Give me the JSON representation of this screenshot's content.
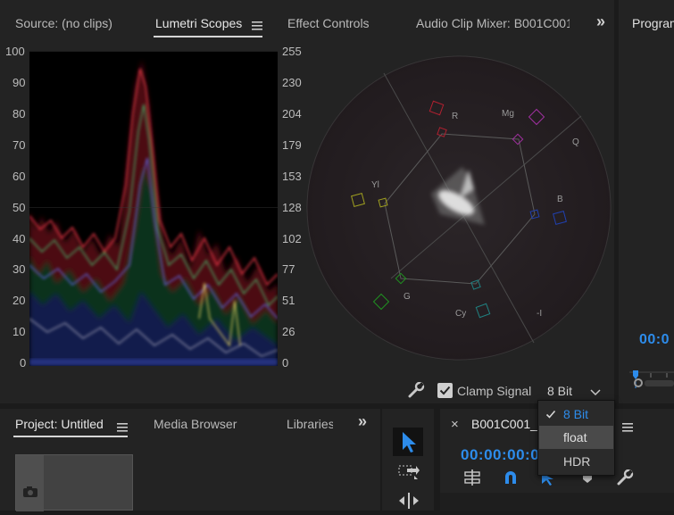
{
  "top_panel": {
    "tabs": [
      {
        "label": "Source: (no clips)"
      },
      {
        "label": "Lumetri Scopes",
        "active": true
      },
      {
        "label": "Effect Controls"
      },
      {
        "label": "Audio Clip Mixer: B001C001"
      }
    ],
    "overflow": "»"
  },
  "program_panel": {
    "title": "Program",
    "timecode": "00:0"
  },
  "waveform": {
    "left_ticks": [
      "100",
      "90",
      "80",
      "70",
      "60",
      "50",
      "40",
      "30",
      "20",
      "10",
      "0"
    ],
    "right_ticks": [
      "255",
      "230",
      "204",
      "179",
      "153",
      "128",
      "102",
      "77",
      "51",
      "26",
      "0"
    ]
  },
  "vectorscope": {
    "labels": {
      "R": "R",
      "Mg": "Mg",
      "Q": "Q",
      "B": "B",
      "Yl": "Yl",
      "G": "G",
      "Cy": "Cy",
      "I": "-I"
    }
  },
  "scope_controls": {
    "clamp_label": "Clamp Signal",
    "clamp_checked": true,
    "bit_depth": "8 Bit",
    "dropdown_options": [
      {
        "label": "8 Bit",
        "checked": true
      },
      {
        "label": "float",
        "highlighted": true
      },
      {
        "label": "HDR"
      }
    ]
  },
  "bottom_left": {
    "tabs": [
      {
        "label": "Project: Untitled",
        "active": true
      },
      {
        "label": "Media Browser"
      },
      {
        "label": "Libraries"
      }
    ],
    "overflow": "»"
  },
  "timeline": {
    "close": "×",
    "sequence_name": "B001C001_",
    "timecode": "00:00:00:0"
  },
  "colors": {
    "accent": "#2d8ceb",
    "panel": "#232323",
    "background": "#1b1b1b"
  }
}
